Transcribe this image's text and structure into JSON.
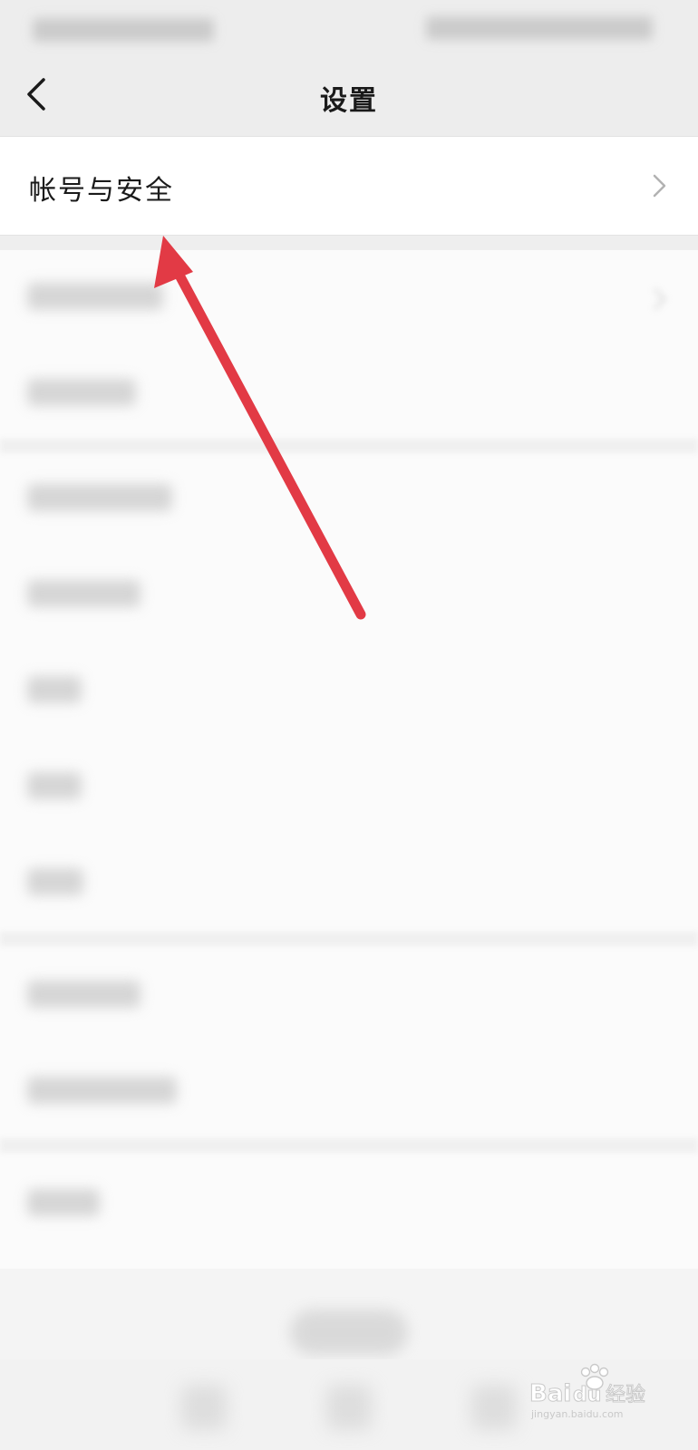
{
  "nav": {
    "title": "设置"
  },
  "settings": {
    "primary_row_label": "帐号与安全"
  },
  "icons": {
    "back": "chevron-left-icon",
    "row_chevron": "chevron-right-icon"
  },
  "colors": {
    "nav_bg": "#ededed",
    "row_bg": "#ffffff",
    "annotation_arrow": "#e23a45"
  }
}
